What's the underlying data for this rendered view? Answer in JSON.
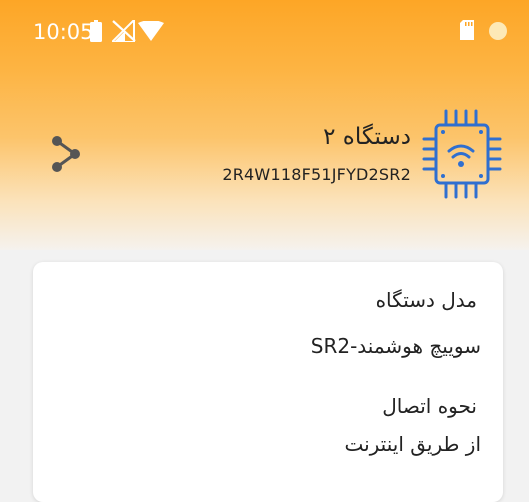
{
  "status_bar": {
    "time": "10:05",
    "colors": {
      "icon": "#ffffff"
    }
  },
  "header": {
    "device_title": "دستگاه ۲",
    "device_serial": "2R4W118F51JFYD2SR2",
    "share_icon": "share-icon",
    "device_icon": "wifi-chip-icon",
    "colors": {
      "gradient_top": "#fda626",
      "icon_blue": "#2f6fd0"
    }
  },
  "details": {
    "model_label": "مدل دستگاه",
    "model_value": "سوییچ هوشمند-SR2",
    "connection_label": "نحوه اتصال",
    "connection_value": "از طریق اینترنت"
  }
}
